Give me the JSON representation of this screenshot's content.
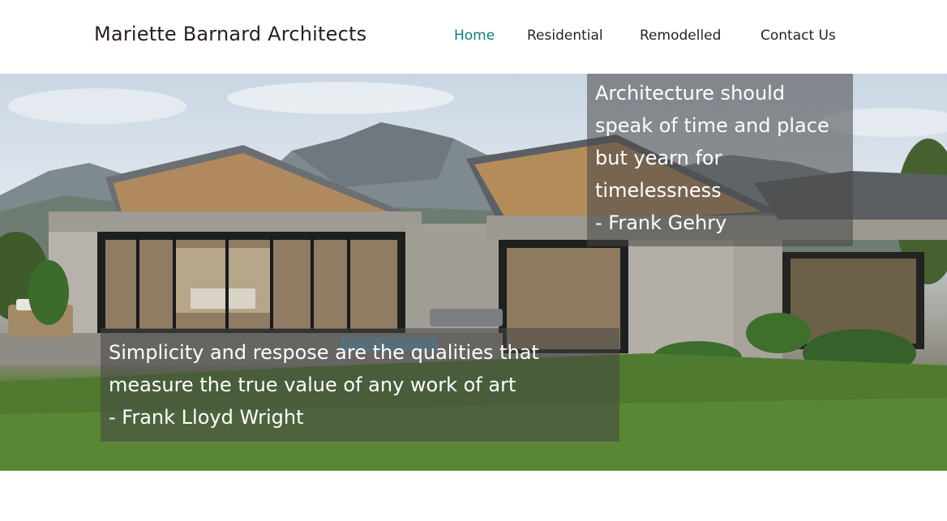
{
  "brand": {
    "name": "Mariette Barnard Architects"
  },
  "nav": {
    "items": [
      {
        "label": "Home",
        "active": true
      },
      {
        "label": "Residential",
        "active": false
      },
      {
        "label": "Remodelled",
        "active": false
      },
      {
        "label": "Contact Us",
        "active": false
      }
    ]
  },
  "colors": {
    "active_nav": "#0f7d7a",
    "text": "#2b1e1e",
    "overlay": "rgba(70,70,70,0.55)"
  },
  "hero": {
    "image": "modern-house-with-mountains",
    "quote_gehry": {
      "lines": [
        "Architecture should",
        "speak of time and place",
        "but yearn for",
        "timelessness",
        "- Frank Gehry"
      ]
    },
    "quote_wright": {
      "lines": [
        "Simplicity and respose are the qualities that",
        "measure the true value of any work of art",
        "- Frank Lloyd Wright"
      ]
    }
  }
}
